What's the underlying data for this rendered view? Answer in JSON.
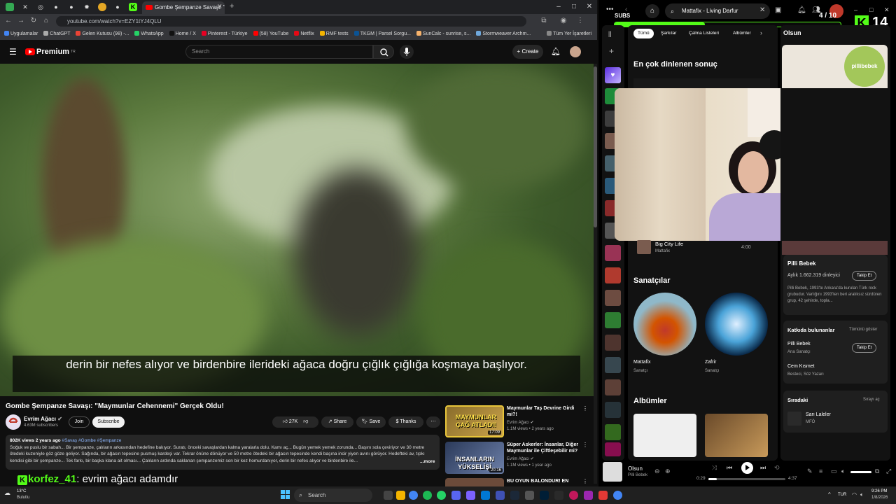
{
  "browser": {
    "active_tab_title": "Gombe Şempanze Savaşı: \"",
    "url": "youtube.com/watch?v=EZY1tYJ4QLU",
    "bookmarks": [
      "Uygulamalar",
      "ChatGPT",
      "Gelen Kutusu (98) -...",
      "WhatsApp",
      "Home / X",
      "Pinterest - Türkiye",
      "(58) YouTube",
      "Netflix",
      "RMF tests",
      "TKGM | Parsel Sorgu...",
      "SunCalc - sunrise, s...",
      "Stormweaver Archm...",
      "Tüm Yer İşaretleri"
    ]
  },
  "youtube": {
    "logo_text": "Premium",
    "logo_sup": "TR",
    "search_placeholder": "Search",
    "create_label": "Create",
    "subtitle": "derin bir nefes alıyor ve birdenbire ilerideki ağaca doğru çığlık çığlığa koşmaya başlıyor.",
    "video_title": "Gombe Şempanze Savaşı: \"Maymunlar Cehennemi\" Gerçek Oldu!",
    "channel_name": "Evrim Ağacı",
    "channel_subs": "4.63M subscribers",
    "join_label": "Join",
    "subscribe_label": "Subscribe",
    "likes": "27K",
    "share_label": "Share",
    "save_label": "Save",
    "thanks_label": "Thanks",
    "desc_meta": "802K views  2 years ago",
    "desc_tags": "#Savaş #Gombe #Şempanze",
    "description": "Soğuk ve puslu bir sabah... Bir şempanze, çalıların arkasından hedefine bakıyor. Suratı, önceki savaşlardan kalma yaralarla dolu. Kamı aç... Bugün yemek yemek zorunda... Başını sola çeviriyor ve 30 metre ötedeki kuzeniyle göz göze geliyor. Sağında, bir ağacın tepesine pusmuş kardeşi var. Tekrar önüne dönüyor ve 50 metre ötedeki bir ağacın tepesinde kendi başına incir yiyen avını görüyor. Hedefteki av, tıpkı kendisi gibi bir şempanze... Tek farkı, bir başka klana ait olması... Çalıların ardında saklanan şempanzemiz son bir kez homurdanıyor, derin bir nefes alıyor ve birdenbire ile...",
    "more_label": "...more",
    "recs": [
      {
        "title": "Maymunlar Taş Devrine Girdi mi?!",
        "channel": "Evrim Ağacı",
        "stats": "1.1M views • 2 years ago",
        "duration": "17:09",
        "thumb_text": "MAYMUNLAR ÇAĞ ATLADI!"
      },
      {
        "title": "Süper Askerler: İnsanlar, Diğer Maymunlar ile Çiftleşebilir mi?",
        "channel": "Evrim Ağacı",
        "stats": "1.1M views • 1 year ago",
        "duration": "20:16",
        "thumb_text": "İNSANLARIN YÜKSELİŞİ"
      },
      {
        "title": "BU OYUN BALONDUR! EN",
        "channel": "",
        "stats": "",
        "duration": "",
        "thumb_text": ""
      }
    ]
  },
  "chat": {
    "user": "korfez_41",
    "message": "evrim ağacı adamdır"
  },
  "spotify": {
    "search_value": "Mattafix - Living Darfur",
    "chips": [
      "Tümü",
      "Şarkılar",
      "Çalma Listeleri",
      "Albümler"
    ],
    "top_result_heading": "En çok dinlenen sonuç",
    "song_row": {
      "title": "Big City Life",
      "artist": "Mattafix",
      "duration": "4:00"
    },
    "artists_heading": "Sanatçılar",
    "artists": [
      {
        "name": "Mattafix",
        "type": "Sanatçı"
      },
      {
        "name": "Zafrir",
        "type": "Sanatçı"
      }
    ],
    "albums_heading": "Albümler",
    "right_panel": {
      "heading": "Olsun",
      "artist": "Pilli Bebek",
      "listeners": "Aylık 1.662.319 dinleyici",
      "follow_label": "Takip Et",
      "bio": "Pilli Bebek, 1993'te Ankara'da kurulan Türk rock grubudur. Varlığını 1993'ten beri aralıksız sürdüren grup, 42 şehirde, topla...",
      "credits_heading": "Katkıda bulunanlar",
      "show_all": "Tümünü göster",
      "credits": [
        {
          "name": "Pilli Bebek",
          "role": "Ana Sanatçı"
        },
        {
          "name": "Cem Kısmet",
          "role": "Besteci, Söz Yazarı"
        }
      ],
      "queue_heading": "Sıradaki",
      "queue_open": "Sırayı aç",
      "queue_song": "Sarı Laleler",
      "queue_artist": "MFÖ",
      "logo_text": "pillibebek"
    },
    "player": {
      "title": "Olsun",
      "artist": "Pilli Bebek",
      "elapsed": "0:29",
      "total": "4:37",
      "progress": 0.105
    }
  },
  "stream": {
    "subs_label": "SUBS",
    "subs_count": "4 / 10",
    "subs_progress": 0.4,
    "viewer_count": "14"
  },
  "taskbar": {
    "weather_temp": "13°C",
    "weather_desc": "Bulutlu",
    "search_label": "Search",
    "lang": "TUR",
    "time": "9:26 PM",
    "date": "1/8/2026"
  },
  "colors": {
    "youtube_red": "#ff0000",
    "spotify_green": "#1db954",
    "kick_green": "#53fc18"
  }
}
